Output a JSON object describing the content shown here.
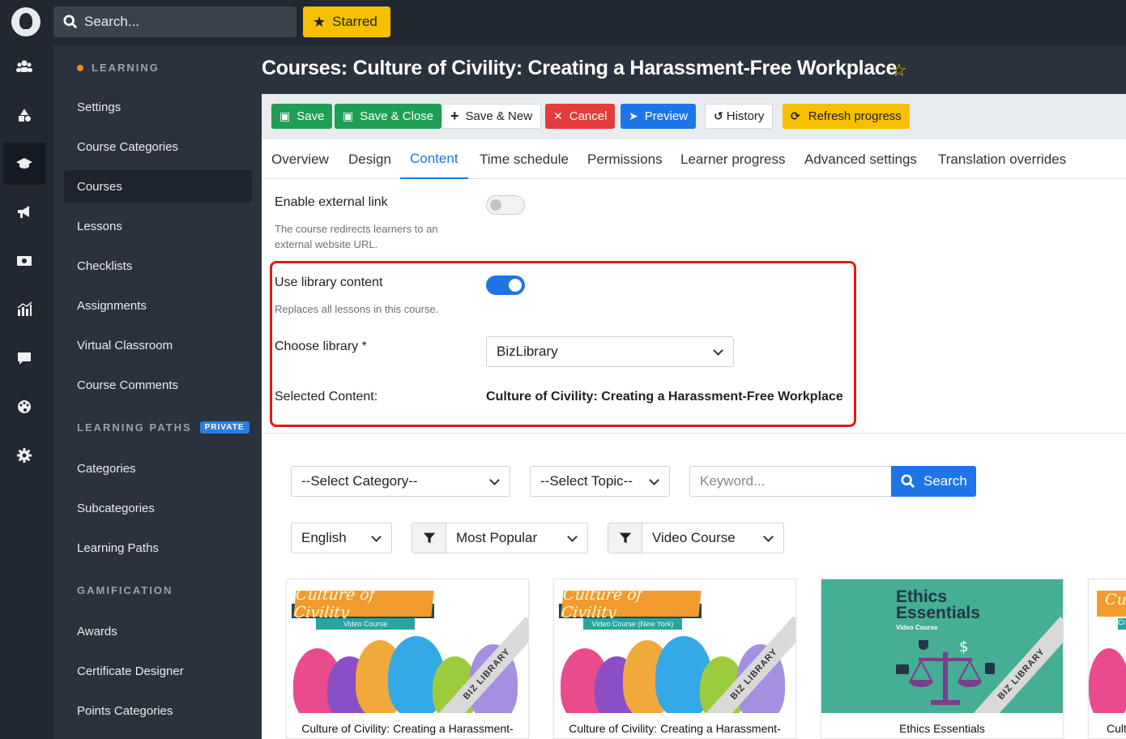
{
  "topbar": {
    "search_placeholder": "Search...",
    "starred_label": "Starred"
  },
  "rail": {
    "icons": [
      "users-icon",
      "shapes-icon",
      "graduation-cap-icon",
      "megaphone-icon",
      "money-icon",
      "analytics-icon",
      "chat-icon",
      "palette-icon",
      "gear-icon"
    ],
    "active_index": 2
  },
  "menu": {
    "sections": [
      {
        "label": "LEARNING",
        "items": [
          "Settings",
          "Course Categories",
          "Courses",
          "Lessons",
          "Checklists",
          "Assignments",
          "Virtual Classroom",
          "Course Comments"
        ]
      },
      {
        "label": "LEARNING PATHS",
        "badge": "PRIVATE",
        "items": [
          "Categories",
          "Subcategories",
          "Learning Paths"
        ]
      },
      {
        "label": "GAMIFICATION",
        "items": [
          "Awards",
          "Certificate Designer",
          "Points Categories"
        ]
      }
    ],
    "active_item": "Courses"
  },
  "page": {
    "title": "Courses: Culture of Civility: Creating a Harassment-Free Workplace"
  },
  "toolbar": {
    "save": "Save",
    "save_close": "Save & Close",
    "save_new": "Save & New",
    "cancel": "Cancel",
    "preview": "Preview",
    "history": "History",
    "refresh": "Refresh progress"
  },
  "tabs": [
    "Overview",
    "Design",
    "Content",
    "Time schedule",
    "Permissions",
    "Learner progress",
    "Advanced settings",
    "Translation overrides"
  ],
  "active_tab": "Content",
  "form": {
    "external_link": {
      "label": "Enable external link",
      "help": "The course redirects learners to an external website URL.",
      "enabled": false
    },
    "library_content": {
      "label": "Use library content",
      "help": "Replaces all lessons in this course.",
      "enabled": true
    },
    "choose_library": {
      "label": "Choose library *",
      "value": "BizLibrary"
    },
    "selected_content": {
      "label": "Selected Content:",
      "value": "Culture of Civility: Creating a Harassment-Free Workplace"
    }
  },
  "filters": {
    "category": "--Select Category--",
    "topic": "--Select Topic--",
    "keyword_placeholder": "Keyword...",
    "search_button": "Search",
    "language": "English",
    "sort": "Most Popular",
    "type": "Video Course"
  },
  "cards": [
    {
      "thumb_title": "Culture of Civility",
      "thumb_sub": "Video Course",
      "badge": "BIZ LIBRARY",
      "title": "Culture of Civility: Creating a Harassment-"
    },
    {
      "thumb_title": "Culture of Civility",
      "thumb_sub": "Video Course (New York)",
      "badge": "BIZ LIBRARY",
      "title": "Culture of Civility: Creating a Harassment-"
    },
    {
      "thumb_title": "Ethics Essentials",
      "thumb_sub": "Video Course",
      "badge": "BIZ LIBRARY",
      "title": "Ethics Essentials"
    },
    {
      "thumb_title": "Cu",
      "thumb_sub": "Cre",
      "title": "Cult"
    }
  ],
  "colors": {
    "accent": "#1e75e8",
    "save_green": "#1f9e55",
    "cancel_red": "#e43b3b",
    "starred_yellow": "#f6c000",
    "highlight_box": "#e01919"
  }
}
